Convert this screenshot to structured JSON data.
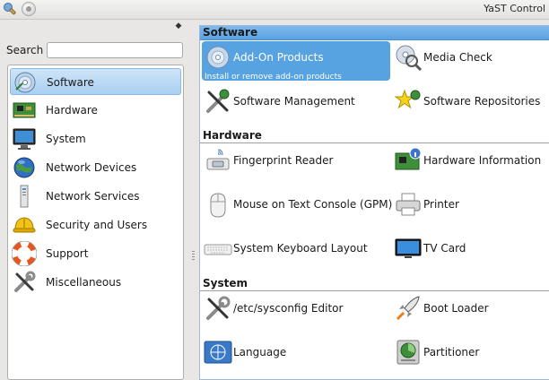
{
  "window": {
    "title": "YaST Control"
  },
  "sidebar": {
    "search_label": "Search",
    "search_value": "",
    "toggle_glyph": "◆",
    "items": [
      {
        "label": "Software",
        "icon": "software-disc-icon",
        "selected": true
      },
      {
        "label": "Hardware",
        "icon": "circuit-board-icon"
      },
      {
        "label": "System",
        "icon": "monitor-icon"
      },
      {
        "label": "Network Devices",
        "icon": "globe-network-icon"
      },
      {
        "label": "Network Services",
        "icon": "network-services-icon"
      },
      {
        "label": "Security and Users",
        "icon": "hard-hat-icon"
      },
      {
        "label": "Support",
        "icon": "lifebuoy-icon"
      },
      {
        "label": "Miscellaneous",
        "icon": "tools-icon"
      }
    ]
  },
  "groups": {
    "software": {
      "title": "Software",
      "modules": [
        {
          "label": "Add-On Products",
          "description": "Install or remove add-on products",
          "icon": "add-on-disc-icon",
          "selected": true
        },
        {
          "label": "Media Check",
          "icon": "media-check-icon"
        },
        {
          "label": "Software Management",
          "icon": "software-management-icon"
        },
        {
          "label": "Software Repositories",
          "icon": "software-repositories-icon"
        }
      ]
    },
    "hardware": {
      "title": "Hardware",
      "modules": [
        {
          "label": "Fingerprint Reader",
          "icon": "fingerprint-reader-icon"
        },
        {
          "label": "Hardware Information",
          "icon": "hardware-information-icon"
        },
        {
          "label": "Mouse on Text Console (GPM)",
          "icon": "mouse-icon"
        },
        {
          "label": "Printer",
          "icon": "printer-icon"
        },
        {
          "label": "System Keyboard Layout",
          "icon": "keyboard-icon"
        },
        {
          "label": "TV Card",
          "icon": "tv-card-icon"
        }
      ]
    },
    "system": {
      "title": "System",
      "modules": [
        {
          "label": "/etc/sysconfig Editor",
          "icon": "sysconfig-editor-icon"
        },
        {
          "label": "Boot Loader",
          "icon": "boot-loader-rocket-icon"
        },
        {
          "label": "Language",
          "icon": "language-globe-icon"
        },
        {
          "label": "Partitioner",
          "icon": "partitioner-disk-icon"
        }
      ]
    }
  },
  "colors": {
    "selection": "#57a3e2",
    "header_active": "#5aa2e3",
    "window_bg": "#e8e7e6"
  }
}
